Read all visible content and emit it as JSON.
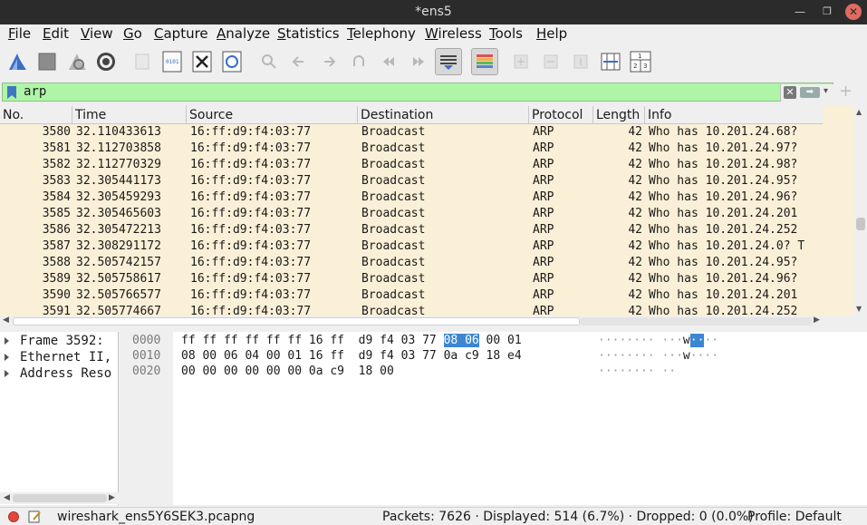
{
  "window": {
    "title": "*ens5"
  },
  "menu": [
    "File",
    "Edit",
    "View",
    "Go",
    "Capture",
    "Analyze",
    "Statistics",
    "Telephony",
    "Wireless",
    "Tools",
    "Help"
  ],
  "toolbar": {
    "buttons": [
      "start-capture",
      "stop-capture",
      "restart-capture",
      "capture-options",
      "open-file",
      "save-file",
      "close-file",
      "reload-file",
      "find-packet",
      "go-back",
      "go-forward",
      "go-to-packet",
      "first-packet",
      "last-packet",
      "autoscroll",
      "colorize",
      "zoom-in",
      "zoom-out",
      "normal-size",
      "resize-columns",
      "resize-columns-2"
    ]
  },
  "filter": {
    "value": "arp"
  },
  "packet_list": {
    "columns": [
      "No.",
      "Time",
      "Source",
      "Destination",
      "Protocol",
      "Length",
      "Info"
    ],
    "rows": [
      {
        "no": "3580",
        "time": "32.110433613",
        "src": "16:ff:d9:f4:03:77",
        "dst": "Broadcast",
        "proto": "ARP",
        "len": "42",
        "info": "Who has 10.201.24.68? "
      },
      {
        "no": "3581",
        "time": "32.112703858",
        "src": "16:ff:d9:f4:03:77",
        "dst": "Broadcast",
        "proto": "ARP",
        "len": "42",
        "info": "Who has 10.201.24.97? "
      },
      {
        "no": "3582",
        "time": "32.112770329",
        "src": "16:ff:d9:f4:03:77",
        "dst": "Broadcast",
        "proto": "ARP",
        "len": "42",
        "info": "Who has 10.201.24.98? "
      },
      {
        "no": "3583",
        "time": "32.305441173",
        "src": "16:ff:d9:f4:03:77",
        "dst": "Broadcast",
        "proto": "ARP",
        "len": "42",
        "info": "Who has 10.201.24.95? "
      },
      {
        "no": "3584",
        "time": "32.305459293",
        "src": "16:ff:d9:f4:03:77",
        "dst": "Broadcast",
        "proto": "ARP",
        "len": "42",
        "info": "Who has 10.201.24.96? "
      },
      {
        "no": "3585",
        "time": "32.305465603",
        "src": "16:ff:d9:f4:03:77",
        "dst": "Broadcast",
        "proto": "ARP",
        "len": "42",
        "info": "Who has 10.201.24.201"
      },
      {
        "no": "3586",
        "time": "32.305472213",
        "src": "16:ff:d9:f4:03:77",
        "dst": "Broadcast",
        "proto": "ARP",
        "len": "42",
        "info": "Who has 10.201.24.252"
      },
      {
        "no": "3587",
        "time": "32.308291172",
        "src": "16:ff:d9:f4:03:77",
        "dst": "Broadcast",
        "proto": "ARP",
        "len": "42",
        "info": "Who has 10.201.24.0? T"
      },
      {
        "no": "3588",
        "time": "32.505742157",
        "src": "16:ff:d9:f4:03:77",
        "dst": "Broadcast",
        "proto": "ARP",
        "len": "42",
        "info": "Who has 10.201.24.95? "
      },
      {
        "no": "3589",
        "time": "32.505758617",
        "src": "16:ff:d9:f4:03:77",
        "dst": "Broadcast",
        "proto": "ARP",
        "len": "42",
        "info": "Who has 10.201.24.96? "
      },
      {
        "no": "3590",
        "time": "32.505766577",
        "src": "16:ff:d9:f4:03:77",
        "dst": "Broadcast",
        "proto": "ARP",
        "len": "42",
        "info": "Who has 10.201.24.201"
      },
      {
        "no": "3591",
        "time": "32.505774667",
        "src": "16:ff:d9:f4:03:77",
        "dst": "Broadcast",
        "proto": "ARP",
        "len": "42",
        "info": "Who has 10.201.24.252"
      }
    ]
  },
  "details": [
    "Frame 3592: ",
    "Ethernet II,",
    "Address Reso"
  ],
  "bytes": {
    "rows": [
      {
        "offset": "0000",
        "hex_a": "ff ff ff ff ff ff 16 ff  d9 f4 03 77 ",
        "hex_hl": "08 06",
        "hex_b": " 00 01",
        "ascii_a": "········ ···",
        "ascii_c": "w",
        "ascii_hl": "··",
        "ascii_b": "··"
      },
      {
        "offset": "0010",
        "hex_a": "08 00 06 04 00 01 16 ff  d9 f4 03 77 0a c9 18 e4",
        "hex_hl": "",
        "hex_b": "",
        "ascii_a": "········ ···",
        "ascii_c": "w",
        "ascii_hl": "",
        "ascii_b": "····"
      },
      {
        "offset": "0020",
        "hex_a": "00 00 00 00 00 00 0a c9  18 00",
        "hex_hl": "",
        "hex_b": "",
        "ascii_a": "········ ··",
        "ascii_c": "",
        "ascii_hl": "",
        "ascii_b": ""
      }
    ]
  },
  "status": {
    "file": "wireshark_ens5Y6SEK3.pcapng",
    "packets": "Packets: 7626 · Displayed: 514 (6.7%) · Dropped: 0 (0.0%)",
    "profile": "Profile: Default"
  }
}
